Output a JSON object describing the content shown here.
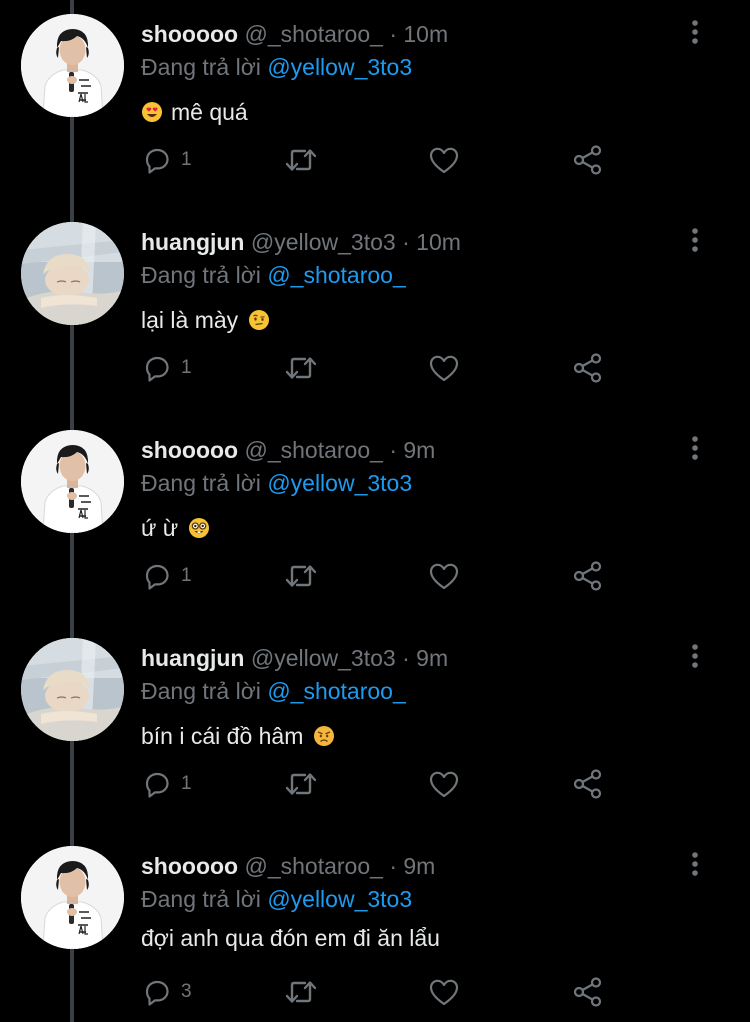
{
  "reply_prefix": "Đang trả lời",
  "colors": {
    "background": "#000000",
    "text_primary": "#e7e9ea",
    "text_secondary": "#71767b",
    "accent_link": "#1d9bf0",
    "thread_line": "#3b3f43"
  },
  "tweets": [
    {
      "name": "shooooo",
      "handle": "@_shotaroo_",
      "time": "10m",
      "reply_to": "@yellow_3to3",
      "text": "mê quá",
      "emoji": "heart-eyes-emoji",
      "emoji_position": "leading",
      "avatar": "shotaro-avatar",
      "reply_count": "1",
      "icons": [
        "reply-icon",
        "retweet-icon",
        "like-icon",
        "share-icon",
        "more-icon"
      ]
    },
    {
      "name": "huangjun",
      "handle": "@yellow_3to3",
      "time": "10m",
      "reply_to": "@_shotaroo_",
      "text": "lại là mày",
      "emoji": "raised-eyebrow-emoji",
      "emoji_position": "trailing",
      "avatar": "huangjun-avatar",
      "reply_count": "1",
      "icons": [
        "reply-icon",
        "retweet-icon",
        "like-icon",
        "share-icon",
        "more-icon"
      ]
    },
    {
      "name": "shooooo",
      "handle": "@_shotaroo_",
      "time": "9m",
      "reply_to": "@yellow_3to3",
      "text": "ứ ừ",
      "emoji": "nerd-face-emoji",
      "emoji_position": "trailing",
      "avatar": "shotaro-avatar",
      "reply_count": "1",
      "icons": [
        "reply-icon",
        "retweet-icon",
        "like-icon",
        "share-icon",
        "more-icon"
      ]
    },
    {
      "name": "huangjun",
      "handle": "@yellow_3to3",
      "time": "9m",
      "reply_to": "@_shotaroo_",
      "text": "bín i cái đồ hâm",
      "emoji": "angry-face-emoji",
      "emoji_position": "trailing",
      "avatar": "huangjun-avatar",
      "reply_count": "1",
      "icons": [
        "reply-icon",
        "retweet-icon",
        "like-icon",
        "share-icon",
        "more-icon"
      ]
    },
    {
      "name": "shooooo",
      "handle": "@_shotaroo_",
      "time": "9m",
      "reply_to": "@yellow_3to3",
      "text": "đợi anh qua đón em đi ăn lẩu",
      "emoji": "",
      "emoji_position": "none",
      "avatar": "shotaro-avatar",
      "reply_count": "3",
      "icons": [
        "reply-icon",
        "retweet-icon",
        "like-icon",
        "share-icon",
        "more-icon"
      ]
    }
  ]
}
